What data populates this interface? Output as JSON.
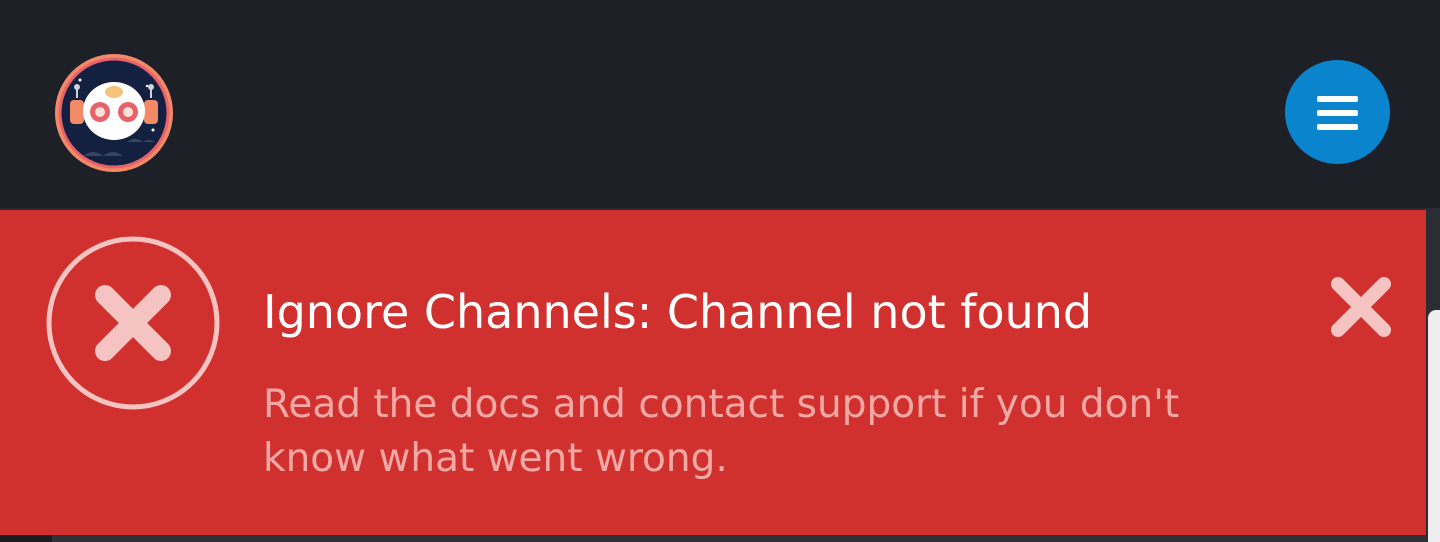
{
  "header": {
    "logo_icon": "robot-mascot-logo",
    "menu_icon": "hamburger-menu-icon",
    "menu_button_color": "#0a84cc",
    "background_color": "#1e2028"
  },
  "alert": {
    "type": "error",
    "status_icon": "error-circle-x-icon",
    "close_icon": "close-x-icon",
    "background_color": "#d0312f",
    "title": "Ignore Channels: Channel not found",
    "message": "Read the docs and contact support if you don't know what went wrong."
  }
}
